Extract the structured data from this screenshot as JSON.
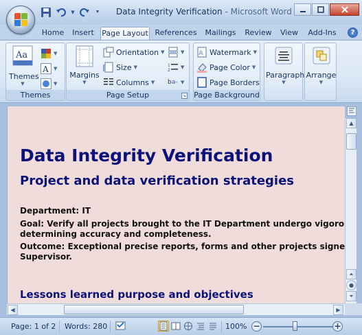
{
  "window": {
    "doc_title": "Data Integrity Verification",
    "separator": " - ",
    "app_name": "Microsoft Word"
  },
  "quick_access": [
    {
      "icon": "save-icon"
    },
    {
      "icon": "undo-icon"
    },
    {
      "icon": "redo-icon"
    },
    {
      "icon": "customize-qat-icon"
    }
  ],
  "tabs": [
    "Home",
    "Insert",
    "Page Layout",
    "References",
    "Mailings",
    "Review",
    "View",
    "Add-Ins"
  ],
  "active_tab": "Page Layout",
  "ribbon": {
    "themes": {
      "label": "Themes",
      "group_label": "Themes"
    },
    "page_setup": {
      "margins": "Margins",
      "orientation": "Orientation",
      "size": "Size",
      "columns": "Columns",
      "group_label": "Page Setup"
    },
    "page_background": {
      "watermark": "Watermark",
      "page_color": "Page Color",
      "page_borders": "Page Borders",
      "group_label": "Page Background"
    },
    "paragraph": "Paragraph",
    "arrange": "Arrange"
  },
  "document": {
    "title": "Data Integrity Verification",
    "subtitle": "Project and data verification strategies",
    "department": "Department:  IT",
    "goal_line1": "Goal:  Verify all projects brought to the IT Department  undergo vigorous an",
    "goal_line2": "determining accuracy  and completeness.",
    "outcome_line1": "Outcome:  Exceptional precise reports, forms and other projects signed off",
    "outcome_line2": "Supervisor.",
    "heading2": "Lessons learned purpose and objectives"
  },
  "status": {
    "page": "Page: 1 of 2",
    "words": "Words: 280",
    "zoom": "100%",
    "zoom_level_percent": 100
  },
  "colors": {
    "page_background": "#f1dcdc",
    "heading_color": "#0d1278",
    "ribbon_base": "#dbe7f5"
  }
}
